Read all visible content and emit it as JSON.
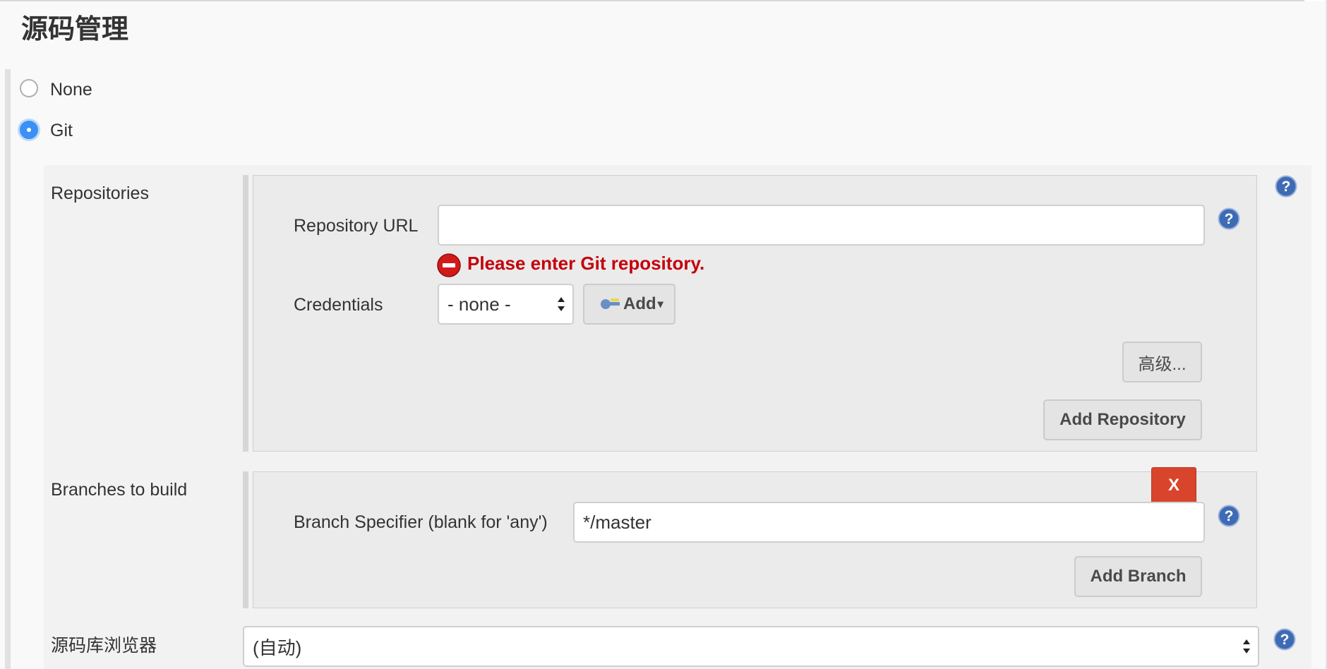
{
  "section": {
    "title": "源码管理"
  },
  "scm_options": [
    {
      "label": "None",
      "selected": false
    },
    {
      "label": "Git",
      "selected": true
    }
  ],
  "repositories": {
    "label": "Repositories",
    "url_label": "Repository URL",
    "url_value": "",
    "error": "Please enter Git repository.",
    "credentials_label": "Credentials",
    "credentials_selected": "- none -",
    "add_credentials_label": "Add",
    "advanced_label": "高级...",
    "add_repository_label": "Add Repository"
  },
  "branches": {
    "label": "Branches to build",
    "delete_label": "X",
    "specifier_label": "Branch Specifier (blank for 'any')",
    "specifier_value": "*/master",
    "add_branch_label": "Add Branch"
  },
  "browser": {
    "label": "源码库浏览器",
    "selected": "(自动)"
  },
  "icons": [
    "help-icon",
    "error-icon",
    "key-icon",
    "dropdown-arrow-icon"
  ],
  "colors": {
    "error": "#c4000a",
    "radio_selected": "#3b8ff5",
    "delete_button": "#d9442c",
    "help_icon": "#3f6bb5"
  }
}
